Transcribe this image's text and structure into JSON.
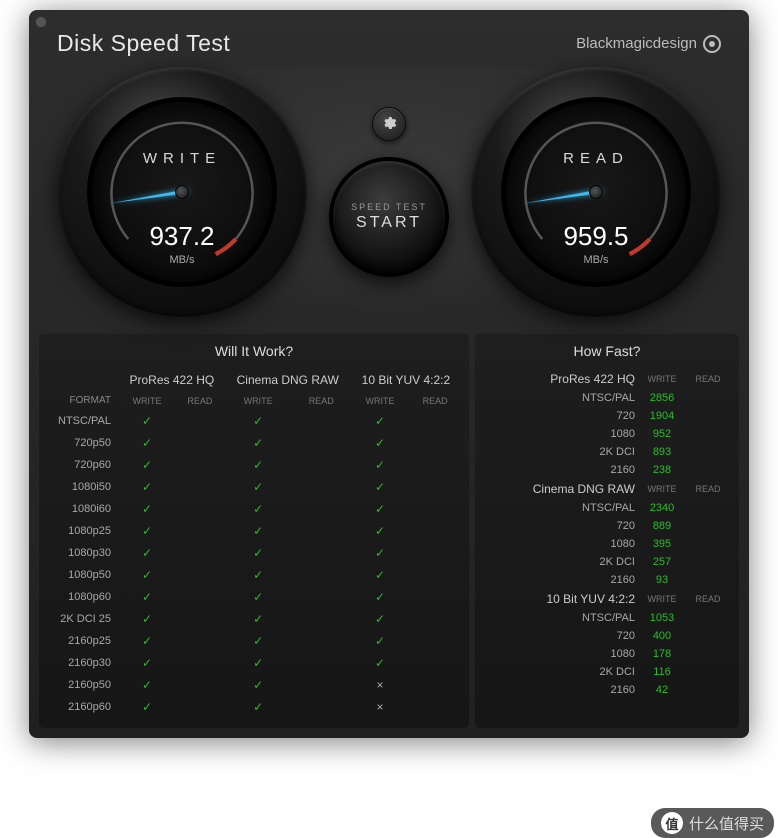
{
  "app": {
    "title": "Disk Speed Test",
    "brand": "Blackmagicdesign"
  },
  "gauges": {
    "write": {
      "label": "WRITE",
      "value": "937.2",
      "unit": "MB/s"
    },
    "read": {
      "label": "READ",
      "value": "959.5",
      "unit": "MB/s"
    }
  },
  "start": {
    "top": "SPEED TEST",
    "main": "START"
  },
  "left_panel": {
    "title": "Will It Work?",
    "format_header": "FORMAT",
    "sub_write": "WRITE",
    "sub_read": "READ",
    "codecs": [
      "ProRes 422 HQ",
      "Cinema DNG RAW",
      "10 Bit YUV 4:2:2"
    ],
    "rows": [
      {
        "fmt": "NTSC/PAL",
        "r": [
          "✓",
          "",
          "✓",
          "",
          "✓",
          ""
        ]
      },
      {
        "fmt": "720p50",
        "r": [
          "✓",
          "",
          "✓",
          "",
          "✓",
          ""
        ]
      },
      {
        "fmt": "720p60",
        "r": [
          "✓",
          "",
          "✓",
          "",
          "✓",
          ""
        ]
      },
      {
        "fmt": "1080i50",
        "r": [
          "✓",
          "",
          "✓",
          "",
          "✓",
          ""
        ]
      },
      {
        "fmt": "1080i60",
        "r": [
          "✓",
          "",
          "✓",
          "",
          "✓",
          ""
        ]
      },
      {
        "fmt": "1080p25",
        "r": [
          "✓",
          "",
          "✓",
          "",
          "✓",
          ""
        ]
      },
      {
        "fmt": "1080p30",
        "r": [
          "✓",
          "",
          "✓",
          "",
          "✓",
          ""
        ]
      },
      {
        "fmt": "1080p50",
        "r": [
          "✓",
          "",
          "✓",
          "",
          "✓",
          ""
        ]
      },
      {
        "fmt": "1080p60",
        "r": [
          "✓",
          "",
          "✓",
          "",
          "✓",
          ""
        ]
      },
      {
        "fmt": "2K DCI 25",
        "r": [
          "✓",
          "",
          "✓",
          "",
          "✓",
          ""
        ]
      },
      {
        "fmt": "2160p25",
        "r": [
          "✓",
          "",
          "✓",
          "",
          "✓",
          ""
        ]
      },
      {
        "fmt": "2160p30",
        "r": [
          "✓",
          "",
          "✓",
          "",
          "✓",
          ""
        ]
      },
      {
        "fmt": "2160p50",
        "r": [
          "✓",
          "",
          "✓",
          "",
          "×",
          ""
        ]
      },
      {
        "fmt": "2160p60",
        "r": [
          "✓",
          "",
          "✓",
          "",
          "×",
          ""
        ]
      }
    ]
  },
  "right_panel": {
    "title": "How Fast?",
    "sub_write": "WRITE",
    "sub_read": "READ",
    "groups": [
      {
        "codec": "ProRes 422 HQ",
        "rows": [
          {
            "fmt": "NTSC/PAL",
            "w": "2856",
            "r": ""
          },
          {
            "fmt": "720",
            "w": "1904",
            "r": ""
          },
          {
            "fmt": "1080",
            "w": "952",
            "r": ""
          },
          {
            "fmt": "2K DCI",
            "w": "893",
            "r": ""
          },
          {
            "fmt": "2160",
            "w": "238",
            "r": ""
          }
        ]
      },
      {
        "codec": "Cinema DNG RAW",
        "rows": [
          {
            "fmt": "NTSC/PAL",
            "w": "2340",
            "r": ""
          },
          {
            "fmt": "720",
            "w": "889",
            "r": ""
          },
          {
            "fmt": "1080",
            "w": "395",
            "r": ""
          },
          {
            "fmt": "2K DCI",
            "w": "257",
            "r": ""
          },
          {
            "fmt": "2160",
            "w": "93",
            "r": ""
          }
        ]
      },
      {
        "codec": "10 Bit YUV 4:2:2",
        "rows": [
          {
            "fmt": "NTSC/PAL",
            "w": "1053",
            "r": ""
          },
          {
            "fmt": "720",
            "w": "400",
            "r": ""
          },
          {
            "fmt": "1080",
            "w": "178",
            "r": ""
          },
          {
            "fmt": "2K DCI",
            "w": "116",
            "r": ""
          },
          {
            "fmt": "2160",
            "w": "42",
            "r": ""
          }
        ]
      }
    ]
  },
  "watermark": {
    "logo": "值",
    "text": "什么值得买"
  }
}
